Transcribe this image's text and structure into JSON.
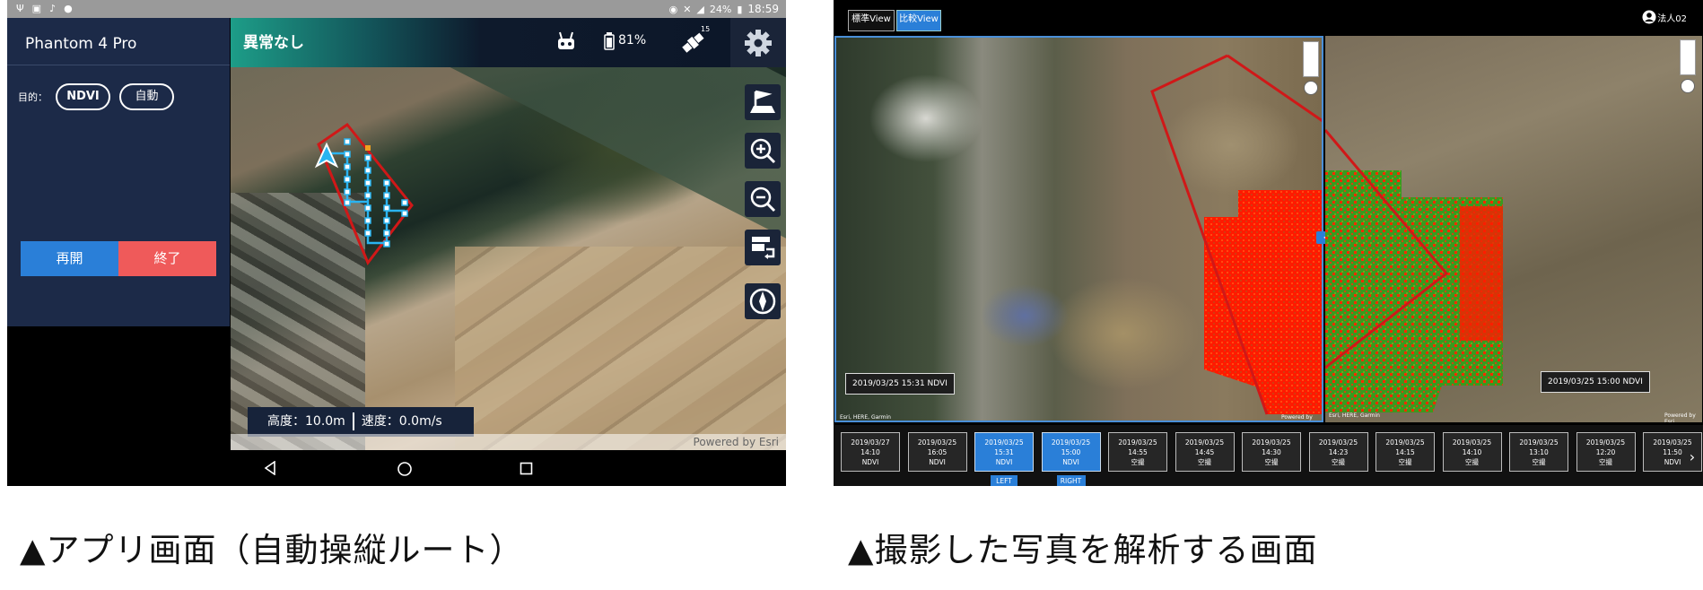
{
  "left_app": {
    "status_bar": {
      "battery": "24%",
      "time": "18:59"
    },
    "sidebar": {
      "title": "Phantom 4 Pro",
      "purpose_label": "目的：",
      "tags": [
        "NDVI",
        "自動"
      ],
      "resume_button": "再開",
      "end_button": "終了"
    },
    "top_bar": {
      "status": "異常なし",
      "battery_level": "81%",
      "satellite_count": "15"
    },
    "telemetry": {
      "altitude": "高度：10.0m",
      "speed": "速度：0.0m/s"
    },
    "attribution": "Powered by Esri"
  },
  "right_app": {
    "tabs": [
      "標準View",
      "比較View"
    ],
    "user": "法人02",
    "left_view_label": "2019/03/25 15:31 NDVI",
    "right_view_label": "2019/03/25 15:00 NDVI",
    "attribution_left": "Esri, HERE, Garmin",
    "attribution_powered": "Powered by Esri",
    "attribution_right": "Esri, HERE, Garmin",
    "timeline": [
      {
        "date": "2019/03/27",
        "time": "14:10",
        "kind": "NDVI"
      },
      {
        "date": "2019/03/25",
        "time": "16:05",
        "kind": "NDVI"
      },
      {
        "date": "2019/03/25",
        "time": "15:31",
        "kind": "NDVI",
        "tag": "LEFT"
      },
      {
        "date": "2019/03/25",
        "time": "15:00",
        "kind": "NDVI",
        "tag": "RIGHT"
      },
      {
        "date": "2019/03/25",
        "time": "14:55",
        "kind": "空撮"
      },
      {
        "date": "2019/03/25",
        "time": "14:45",
        "kind": "空撮"
      },
      {
        "date": "2019/03/25",
        "time": "14:30",
        "kind": "空撮"
      },
      {
        "date": "2019/03/25",
        "time": "14:23",
        "kind": "空撮"
      },
      {
        "date": "2019/03/25",
        "time": "14:15",
        "kind": "空撮"
      },
      {
        "date": "2019/03/25",
        "time": "14:10",
        "kind": "空撮"
      },
      {
        "date": "2019/03/25",
        "time": "13:10",
        "kind": "空撮"
      },
      {
        "date": "2019/03/25",
        "time": "12:20",
        "kind": "空撮"
      },
      {
        "date": "2019/03/25",
        "time": "11:50",
        "kind": "NDVI"
      }
    ]
  },
  "captions": {
    "left": "▲アプリ画面（自動操縦ルート）",
    "right": "▲撮影した写真を解析する画面"
  },
  "colors": {
    "accent_blue": "#2a7fd8",
    "end_red": "#ef5a5a",
    "route_red": "#d01818",
    "waypoint_cyan": "#2ab4f0",
    "ndvi_red": "#ff1a00",
    "ndvi_green": "#3a9a1e"
  }
}
